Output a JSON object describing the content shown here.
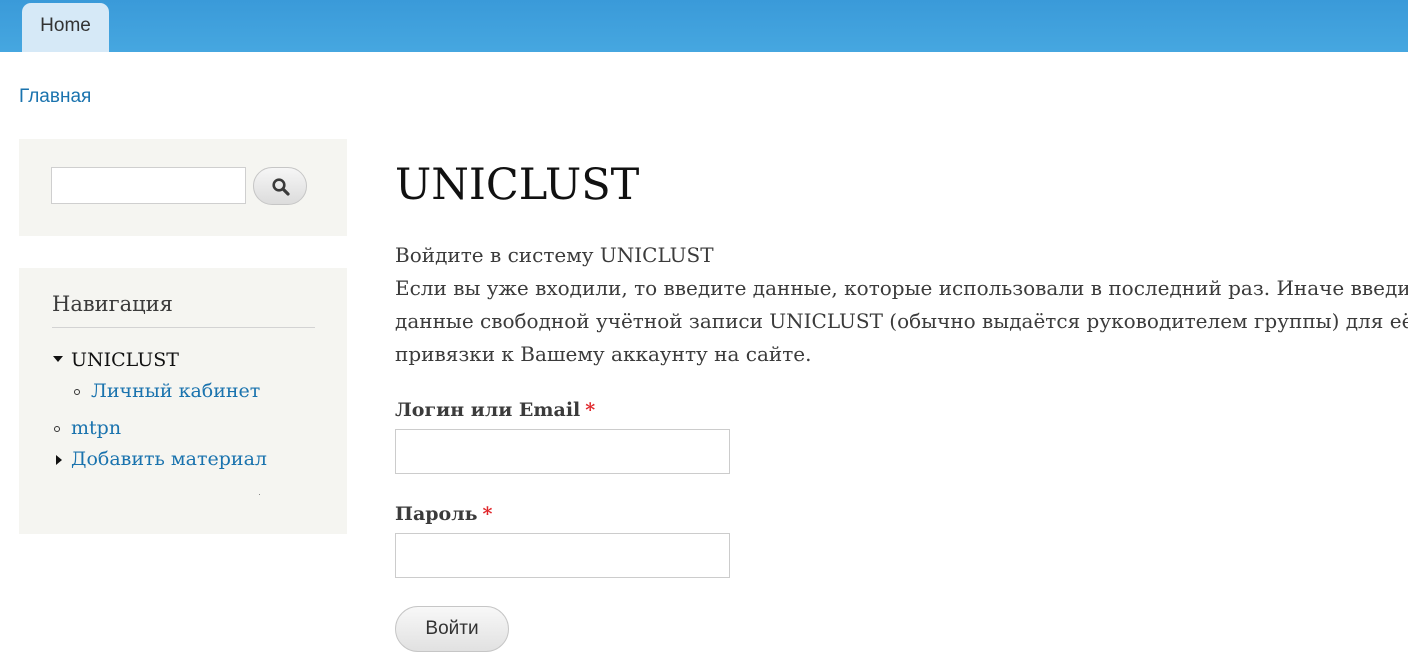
{
  "header": {
    "tabs": [
      {
        "label": "Home"
      }
    ]
  },
  "breadcrumb": {
    "items": [
      {
        "label": "Главная"
      }
    ]
  },
  "sidebar": {
    "search": {
      "value": "",
      "button_icon": "search-icon"
    },
    "navigation": {
      "title": "Навигация",
      "items": [
        {
          "label": "UNICLUST",
          "marker": "triangle-down",
          "active": true
        },
        {
          "label": "Личный кабинет",
          "marker": "circle",
          "level": 2
        },
        {
          "label": "mtpn",
          "marker": "circle"
        },
        {
          "label": "Добавить материал",
          "marker": "triangle-right"
        }
      ]
    }
  },
  "main": {
    "title": "UNICLUST",
    "intro": {
      "lines": [
        "Войдите в систему UNICLUST",
        "Если вы уже входили, то введите данные, которые использовали в последний раз. Иначе введите",
        "данные свободной учётной записи UNICLUST (обычно выдаётся руководителем группы) для её",
        "привязки к Вашему аккаунту на сайте."
      ]
    },
    "form": {
      "login": {
        "label": "Логин или Email",
        "required_mark": "*",
        "value": ""
      },
      "password": {
        "label": "Пароль",
        "required_mark": "*",
        "value": ""
      },
      "submit_label": "Войти"
    }
  },
  "colors": {
    "header_bar": "#3a9ad9",
    "tab_active_bg": "#d6e9f7",
    "link": "#1a73ae",
    "sidebar_bg": "#f5f5f1",
    "required": "#e0272b"
  }
}
